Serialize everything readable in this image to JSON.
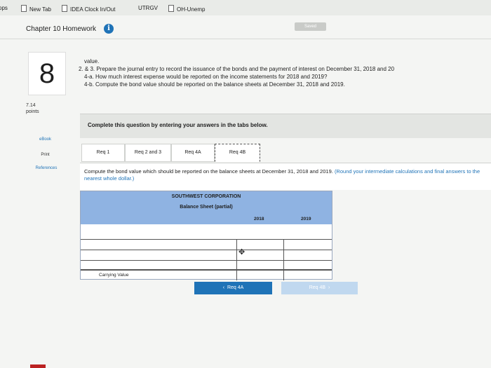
{
  "bookmarks": {
    "apps": "pps",
    "new_tab": "New Tab",
    "idea_clock": "IDEA Clock In/Out",
    "utrgv": "UTRGV",
    "oh_unemp": "OH-Unemp"
  },
  "header": {
    "title": "Chapter 10 Homework",
    "info_icon": "i",
    "saved": "Saved"
  },
  "question": {
    "number": "8",
    "lines": [
      "value.",
      "2. & 3. Prepare the journal entry to record the issuance of the bonds and the payment of interest on December 31, 2018 and 20",
      "4-a. How much interest expense would be reported on the income statements for 2018 and 2019?",
      "4-b. Compute the bond value should be reported on the balance sheets at December 31, 2018 and 2019."
    ],
    "points_value": "7.14",
    "points_label": "points"
  },
  "side": {
    "ebook": "eBook",
    "print": "Print",
    "references": "References"
  },
  "banner": "Complete this question by entering your answers in the tabs below.",
  "tabs": [
    {
      "label": "Req 1"
    },
    {
      "label": "Req 2 and 3"
    },
    {
      "label": "Req 4A"
    },
    {
      "label": "Req 4B"
    }
  ],
  "instructions": {
    "main": "Compute the bond value which should be reported on the balance sheets at December 31, 2018 and 2019.",
    "note": "(Round your intermediate calculations and final answers to the nearest whole dollar.)"
  },
  "balance_sheet": {
    "company": "SOUTHWEST CORPORATION",
    "subtitle": "Balance Sheet (partial)",
    "year1": "2018",
    "year2": "2019",
    "rows": [
      {
        "label": "",
        "v2018": "",
        "v2019": ""
      },
      {
        "label": "",
        "v2018": "",
        "v2019": ""
      },
      {
        "label": "",
        "v2018": "",
        "v2019": ""
      }
    ],
    "total_label": "Carrying Value"
  },
  "nav": {
    "prev": "Req 4A",
    "next": "Req 4B"
  },
  "colors": {
    "accent": "#1f73b7",
    "table_header": "#8fb3e2"
  }
}
